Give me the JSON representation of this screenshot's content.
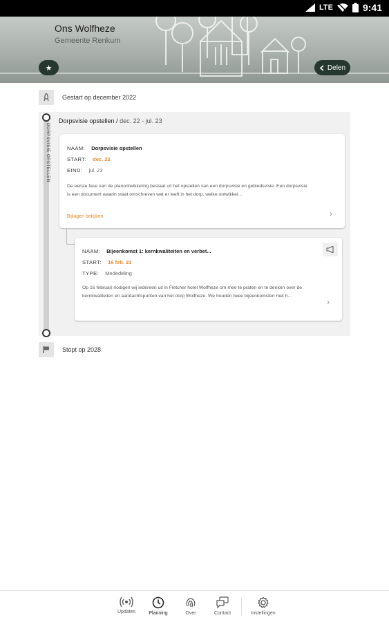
{
  "status_bar": {
    "network": "LTE",
    "time": "9:41"
  },
  "header": {
    "title": "Ons Wolfheze",
    "subtitle": "Gemeente Renkum",
    "favorite_icon": "star-icon",
    "share_label": "Delen",
    "share_icon": "share-icon"
  },
  "timeline": {
    "start_label": "Gestart op december 2022",
    "stop_label": "Stopt op 2028",
    "phase": {
      "vertical_label": "DORPSVISIE OPSTELLEN",
      "title": "Dorpsvisie opstellen",
      "dates": "dec. 22 - jul. 23",
      "card": {
        "name_key": "NAAM:",
        "name_value": "Dorpsvisie opstellen",
        "start_key": "START:",
        "start_value": "dec. 22",
        "end_key": "EIND:",
        "end_value": "jul. 23",
        "description": "De eerste fase van de planontwikkeling bestaat uit het opstellen van een dorpsvisie en gebiedsvisie. Een dorpsvisie is een document waarin staat omschreven wat er leeft in het dorp, welke ontwikkel...",
        "link_label": "Bijlagen bekijken"
      },
      "update_card": {
        "name_key": "NAAM:",
        "name_value": "Bijeenkomst 1: kernkwaliteiten en verbet...",
        "start_key": "START:",
        "start_value": "16 feb. 23",
        "type_key": "TYPE:",
        "type_value": "Mededeling",
        "description": "Op 16 februari nodigen wij iedereen uit in Fletcher hotel Wolfheze om mee te praten en te denken over de kernkwaliteiten en aandachtspunten van het dorp Wolfheze. We houden twee bijeenkomsten met h..."
      }
    }
  },
  "tabs": [
    {
      "label": "Updates",
      "icon": "broadcast-icon"
    },
    {
      "label": "Planning",
      "icon": "clock-icon",
      "active": true
    },
    {
      "label": "Over",
      "icon": "fingerprint-icon"
    },
    {
      "label": "Contact",
      "icon": "chat-icon"
    },
    {
      "label": "Instellingen",
      "icon": "gear-icon"
    }
  ],
  "colors": {
    "accent": "#e38b2c",
    "dark_button": "#25372e"
  }
}
